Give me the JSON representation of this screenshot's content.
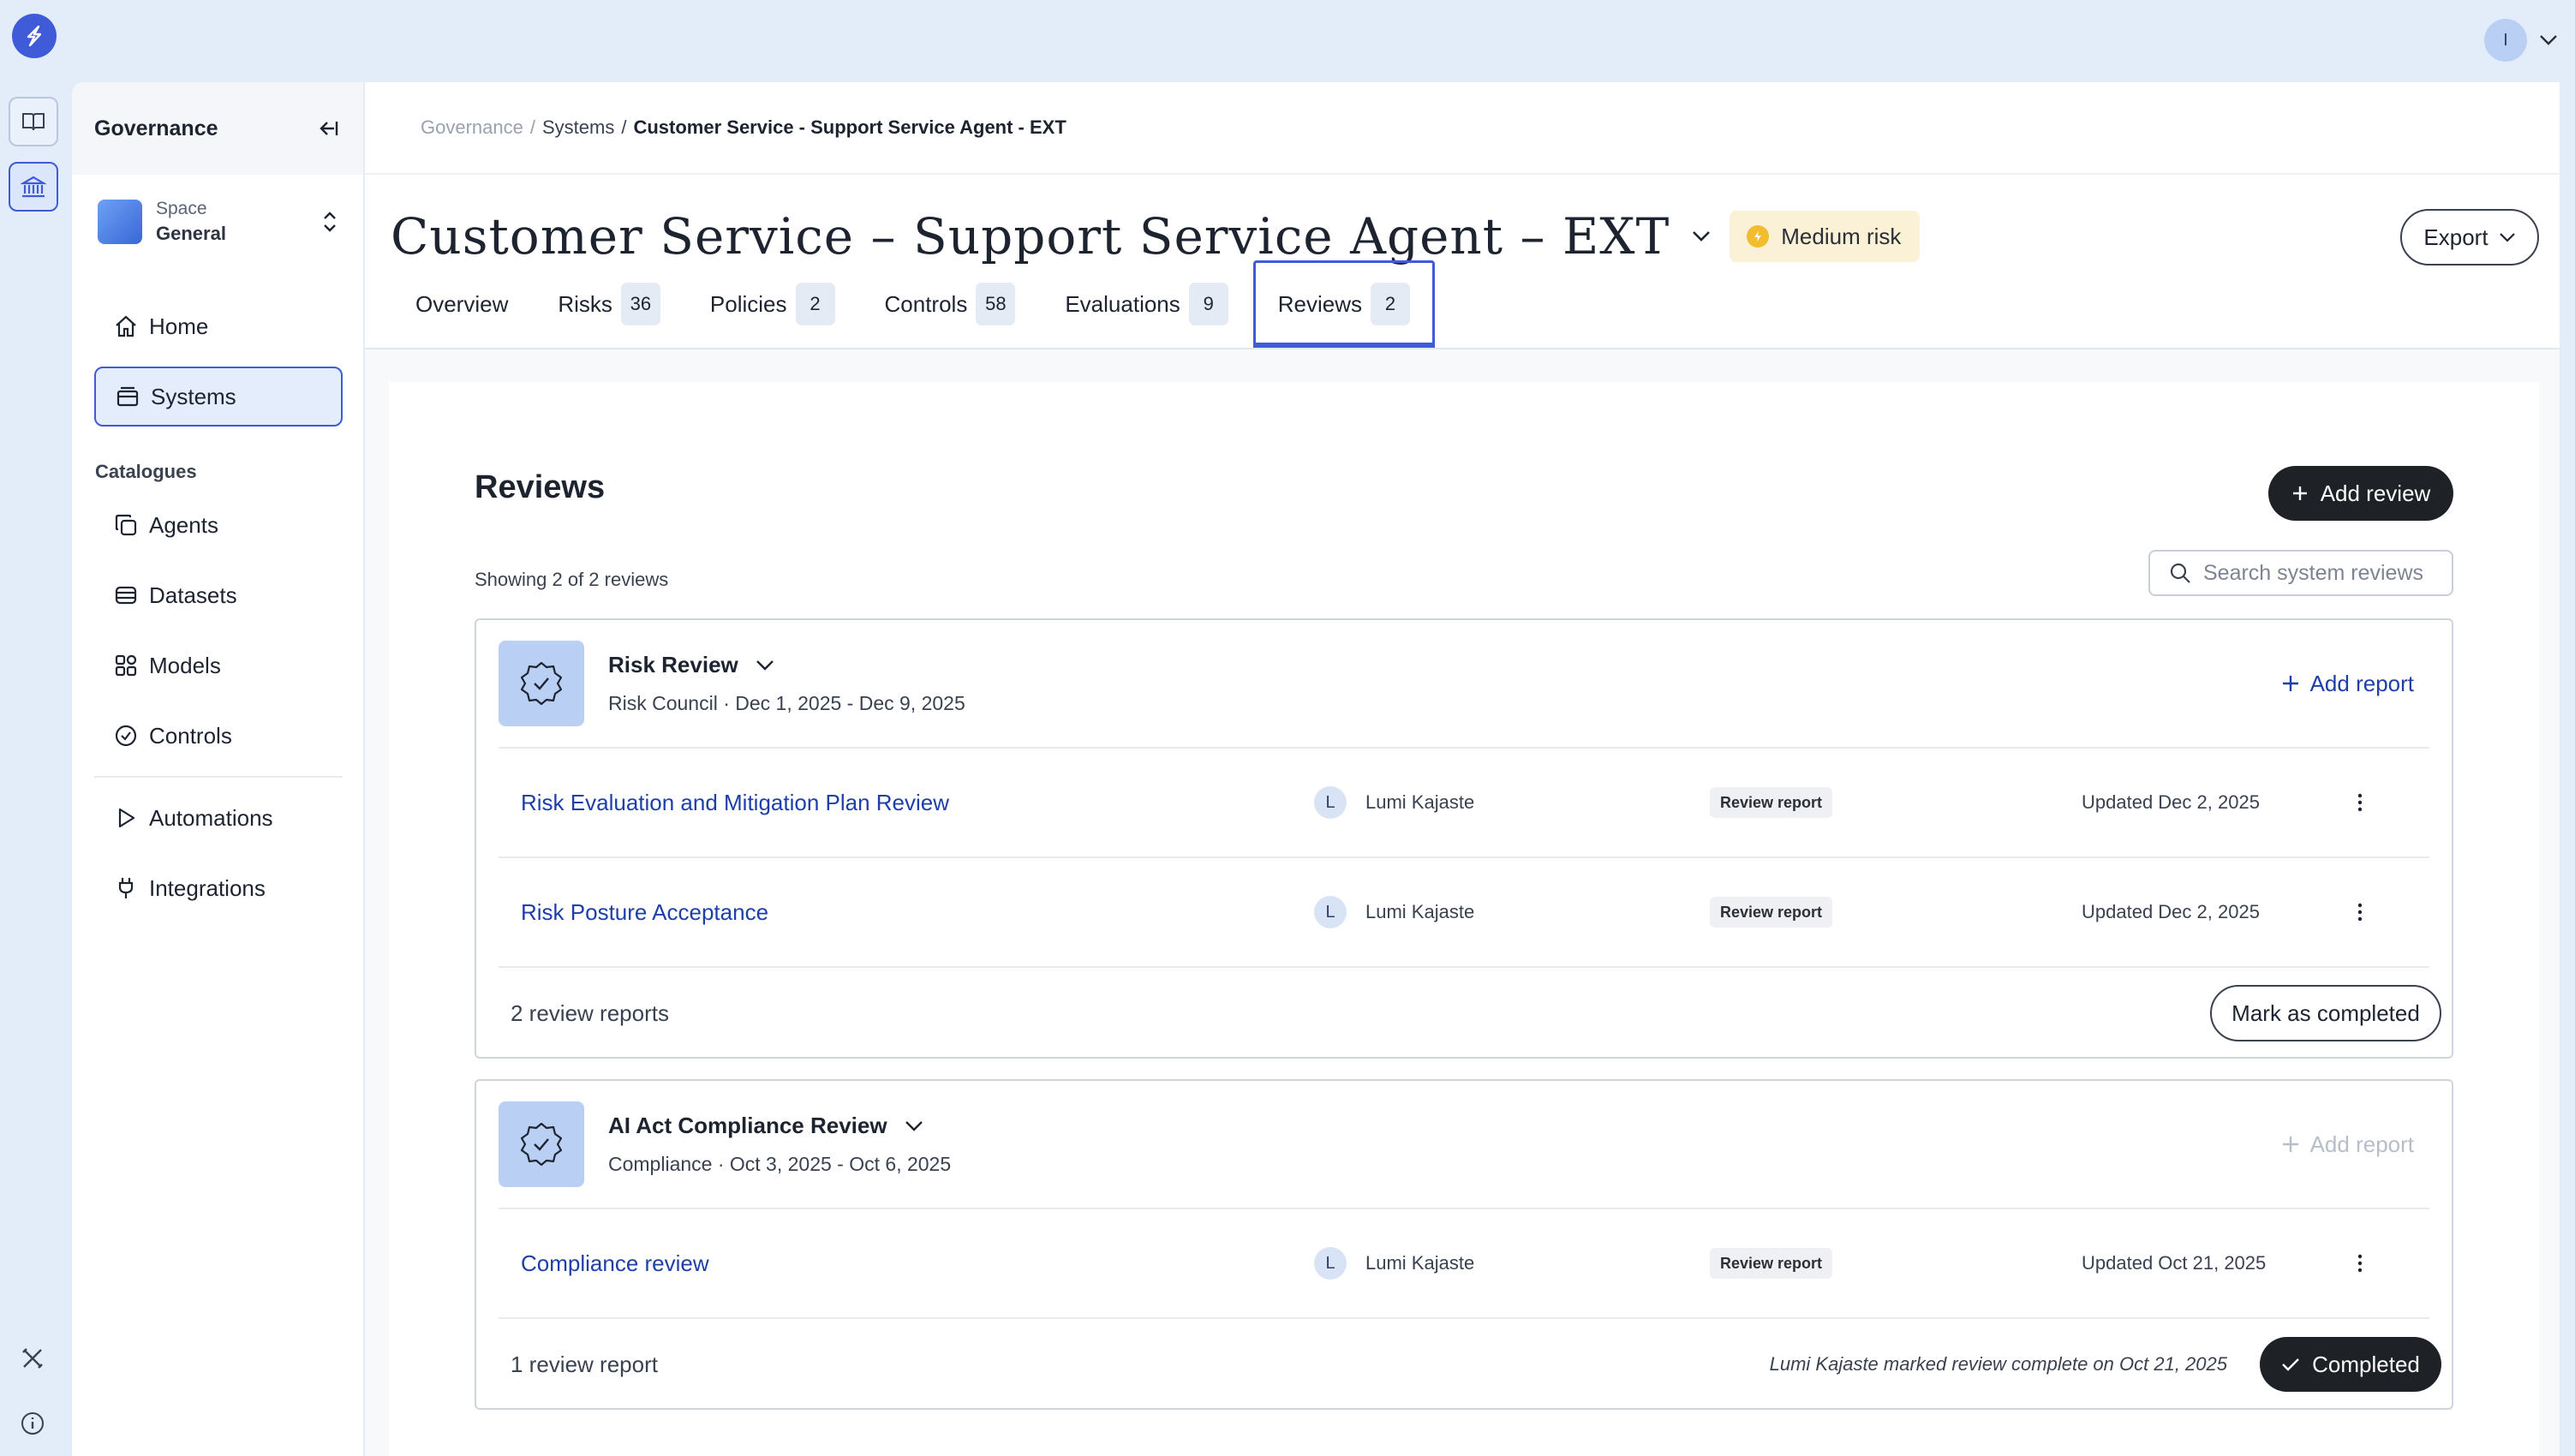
{
  "topbar": {
    "user_initial": "I"
  },
  "sidebar": {
    "title": "Governance",
    "space": {
      "label": "Space",
      "name": "General"
    },
    "nav": [
      {
        "label": "Home",
        "icon": "home-icon"
      },
      {
        "label": "Systems",
        "icon": "systems-icon",
        "active": true
      }
    ],
    "catalogues_label": "Catalogues",
    "catalogues": [
      {
        "label": "Agents",
        "icon": "agents-icon"
      },
      {
        "label": "Datasets",
        "icon": "datasets-icon"
      },
      {
        "label": "Models",
        "icon": "models-icon"
      },
      {
        "label": "Controls",
        "icon": "controls-icon"
      }
    ],
    "extra": [
      {
        "label": "Automations",
        "icon": "play-icon"
      },
      {
        "label": "Integrations",
        "icon": "plug-icon"
      }
    ]
  },
  "breadcrumb": {
    "root": "Governance",
    "sep1": "/",
    "mid": "Systems",
    "sep2": "/",
    "current": "Customer Service - Support Service Agent - EXT"
  },
  "header": {
    "title": "Customer Service – Support Service Agent – EXT",
    "risk": "Medium risk",
    "export_label": "Export"
  },
  "tabs": [
    {
      "label": "Overview",
      "count": ""
    },
    {
      "label": "Risks",
      "count": "36"
    },
    {
      "label": "Policies",
      "count": "2"
    },
    {
      "label": "Controls",
      "count": "58"
    },
    {
      "label": "Evaluations",
      "count": "9"
    },
    {
      "label": "Reviews",
      "count": "2",
      "active": true
    }
  ],
  "reviews": {
    "title": "Reviews",
    "add_label": "Add review",
    "showing": "Showing 2 of 2 reviews",
    "search_placeholder": "Search system reviews",
    "groups": [
      {
        "name": "Risk Review",
        "meta": "Risk Council · Dec 1, 2025 - Dec 9, 2025",
        "add_report": "Add report",
        "reports": [
          {
            "title": "Risk Evaluation and Mitigation Plan Review",
            "owner_initial": "L",
            "owner": "Lumi Kajaste",
            "type": "Review report",
            "updated": "Updated Dec 2, 2025"
          },
          {
            "title": "Risk Posture Acceptance",
            "owner_initial": "L",
            "owner": "Lumi Kajaste",
            "type": "Review report",
            "updated": "Updated Dec 2, 2025"
          }
        ],
        "footer_count": "2 review reports",
        "footer_action": "Mark as completed"
      },
      {
        "name": "AI Act Compliance Review",
        "meta": "Compliance · Oct 3, 2025 - Oct 6, 2025",
        "add_report": "Add report",
        "reports": [
          {
            "title": "Compliance review",
            "owner_initial": "L",
            "owner": "Lumi Kajaste",
            "type": "Review report",
            "updated": "Updated Oct 21, 2025"
          }
        ],
        "footer_count": "1 review report",
        "footer_note": "Lumi Kajaste marked review complete on Oct 21, 2025",
        "footer_action": "Completed"
      }
    ]
  },
  "colors": {
    "accent": "#3f5bd8",
    "link": "#1f3fa8",
    "risk_medium": "#f1bd2f",
    "background": "#e3edf9"
  }
}
